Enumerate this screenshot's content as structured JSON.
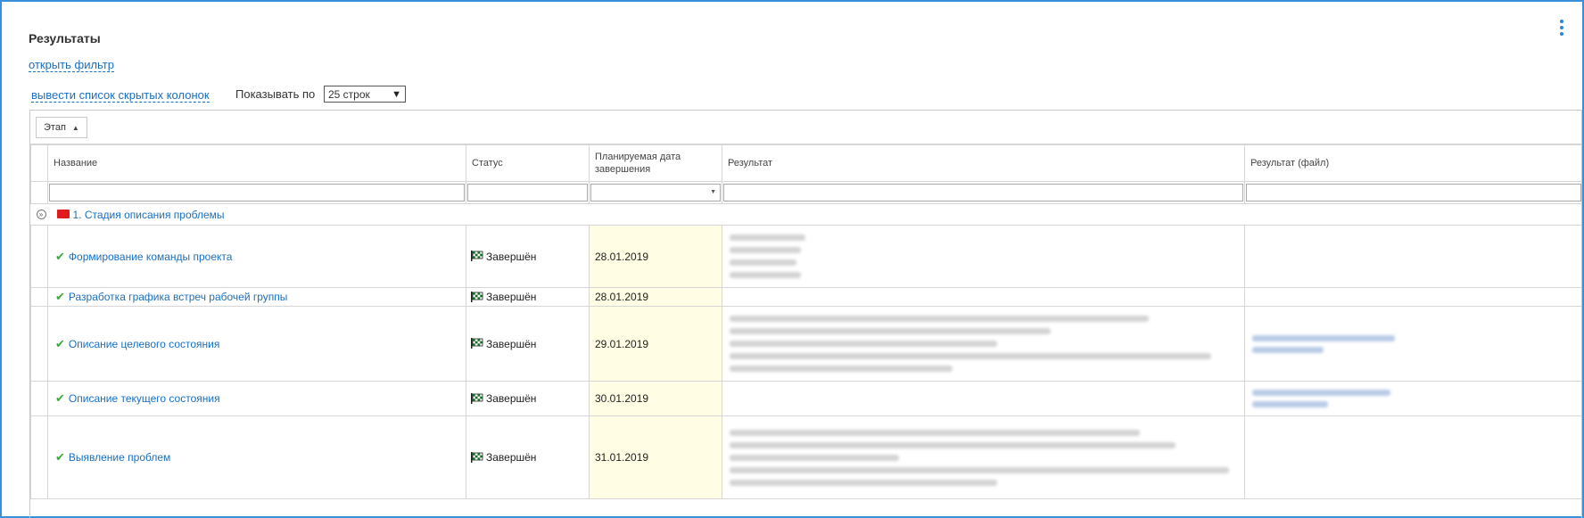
{
  "panel": {
    "title": "Результаты",
    "open_filter": "открыть фильтр",
    "hidden_columns": "вывести список скрытых колонок",
    "pager_label": "Показывать по",
    "pager_value": "25 строк"
  },
  "grouping": {
    "label": "Этап"
  },
  "columns": {
    "name": "Название",
    "status": "Статус",
    "planned_date": "Планируемая дата завершения",
    "result": "Результат",
    "result_file": "Результат (файл)"
  },
  "group": {
    "label": "1. Стадия описания проблемы"
  },
  "rows": [
    {
      "name": "Формирование команды проекта",
      "status": "Завершён",
      "date": "28.01.2019"
    },
    {
      "name": "Разработка графика встреч рабочей группы",
      "status": "Завершён",
      "date": "28.01.2019"
    },
    {
      "name": "Описание целевого состояния",
      "status": "Завершён",
      "date": "29.01.2019"
    },
    {
      "name": "Описание текущего состояния",
      "status": "Завершён",
      "date": "30.01.2019"
    },
    {
      "name": "Выявление проблем",
      "status": "Завершён",
      "date": "31.01.2019"
    }
  ],
  "icons": {
    "kebab": "more-vertical-icon",
    "check": "check-icon",
    "flag": "finish-flag-icon",
    "folder": "folder-icon",
    "collapse": "collapse-circle-icon"
  },
  "colors": {
    "accent": "#1a6fc0",
    "frame": "#3a8fd9",
    "date_highlight": "#fffde3",
    "folder": "#e01b1b",
    "check": "#3ea83e"
  }
}
